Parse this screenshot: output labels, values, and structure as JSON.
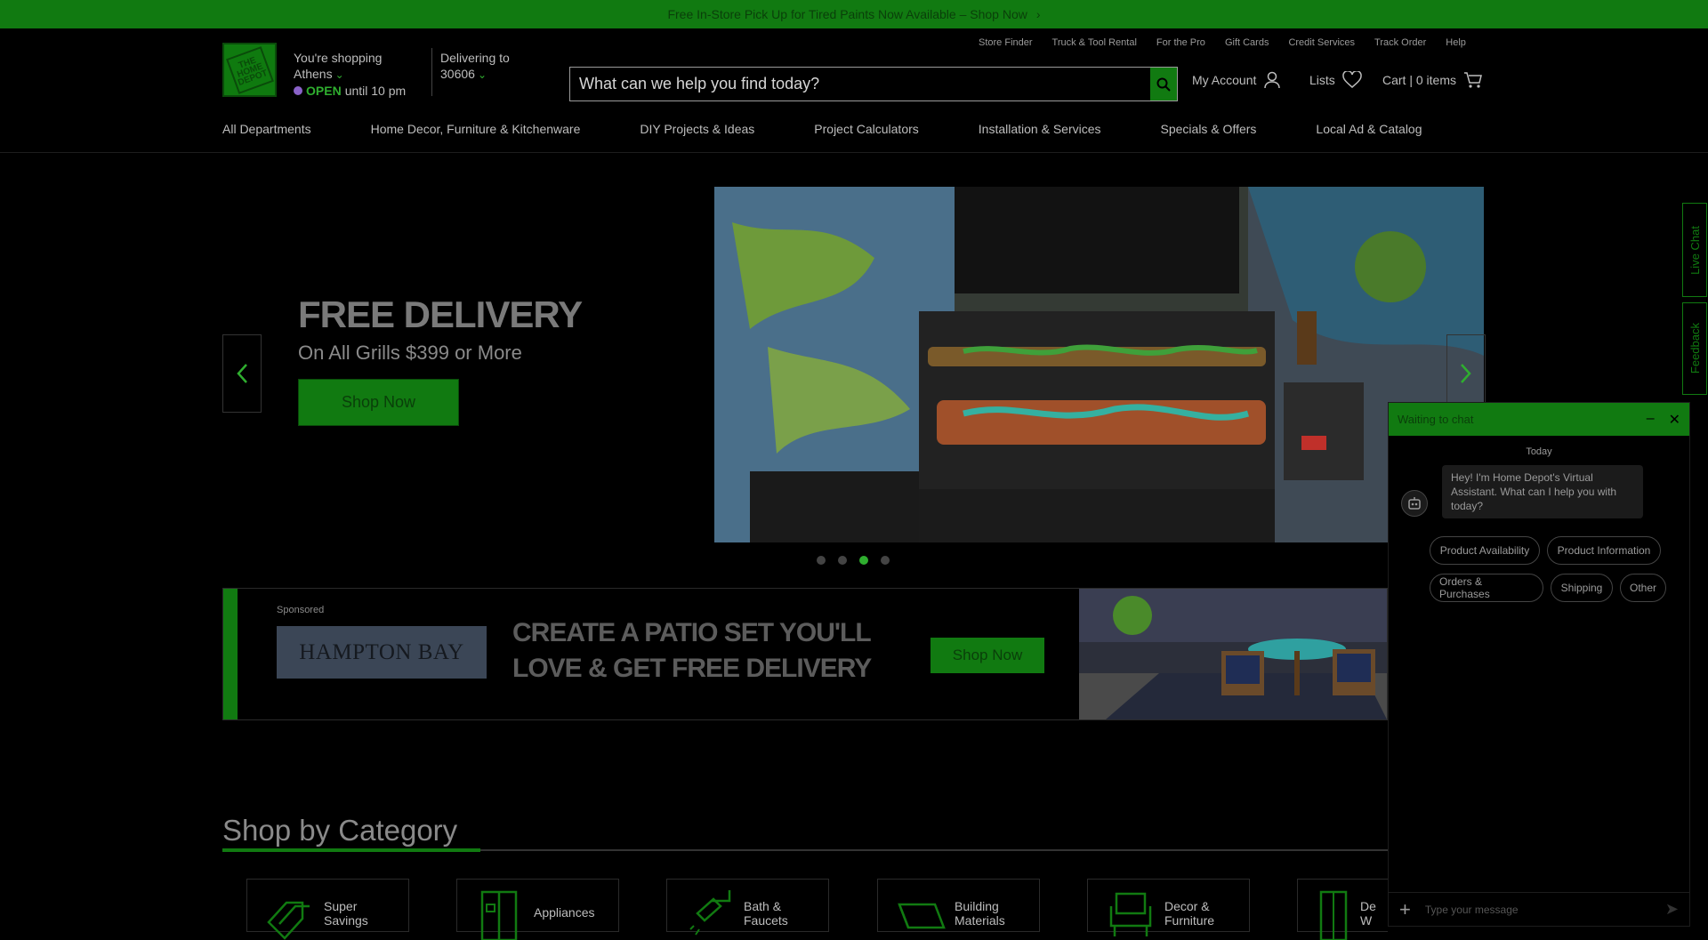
{
  "promo": {
    "text": "Free In-Store Pick Up for Tired Paints Now Available – Shop Now",
    "chevron": "›"
  },
  "logo": {
    "text": "THE HOME DEPOT"
  },
  "store": {
    "line1": "You're shopping",
    "city": "Athens",
    "open": "OPEN",
    "hours": "until 10 pm"
  },
  "delivery": {
    "label": "Delivering to",
    "zip": "30606"
  },
  "util_links": [
    "Store Finder",
    "Truck & Tool Rental",
    "For the Pro",
    "Gift Cards",
    "Credit Services",
    "Track Order",
    "Help"
  ],
  "search": {
    "placeholder": "What can we help you find today?"
  },
  "account": {
    "my_account": "My Account",
    "lists": "Lists",
    "cart": "Cart | 0 items"
  },
  "nav": [
    "All Departments",
    "Home Decor, Furniture & Kitchenware",
    "DIY Projects & Ideas",
    "Project Calculators",
    "Installation & Services",
    "Specials & Offers",
    "Local Ad & Catalog"
  ],
  "hero": {
    "title": "FREE DELIVERY",
    "subtitle": "On All Grills $399 or More",
    "button": "Shop Now",
    "active_slide": 3,
    "slides": 4
  },
  "banner": {
    "sponsored": "Sponsored",
    "brand": "HAMPTON BAY",
    "headline_1": "CREATE A PATIO SET YOU'LL",
    "headline_2": "LOVE & GET FREE DELIVERY",
    "button": "Shop Now"
  },
  "category": {
    "title": "Shop by Category",
    "items": [
      {
        "line1": "Super",
        "line2": "Savings"
      },
      {
        "line1": "Appliances",
        "line2": ""
      },
      {
        "line1": "Bath &",
        "line2": "Faucets"
      },
      {
        "line1": "Building",
        "line2": "Materials"
      },
      {
        "line1": "Decor &",
        "line2": "Furniture"
      },
      {
        "line1": "De",
        "line2": "W"
      }
    ]
  },
  "side_tabs": {
    "live_chat": "Live Chat",
    "feedback": "Feedback"
  },
  "chat": {
    "title": "Waiting to chat",
    "day": "Today",
    "message": "Hey! I'm Home Depot's Virtual Assistant. What can I help you with today?",
    "chips": [
      "Product Availability",
      "Product Information",
      "Orders & Purchases",
      "Shipping",
      "Other"
    ],
    "input_placeholder": "Type your message"
  },
  "colors": {
    "brand_green": "#117a11",
    "accent_green": "#2fae2f"
  }
}
